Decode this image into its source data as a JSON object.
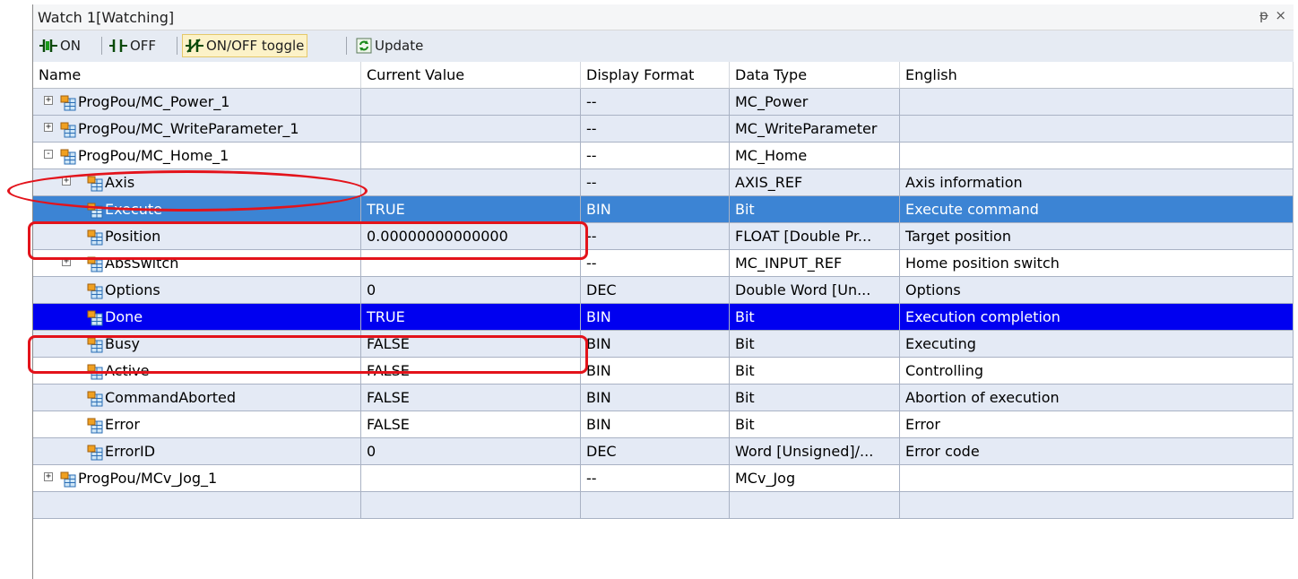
{
  "window": {
    "title": "Watch 1[Watching]",
    "pin_glyph": "ᵽ",
    "close_glyph": "×"
  },
  "toolbar": {
    "on_label": "ON",
    "off_label": "OFF",
    "toggle_label": "ON/OFF toggle",
    "update_label": "Update"
  },
  "columns": [
    "Name",
    "Current Value",
    "Display Format",
    "Data Type",
    "English"
  ],
  "rows": [
    {
      "name": "ProgPou/MC_Power_1",
      "value": "",
      "format": "--",
      "type": "MC_Power",
      "english": "",
      "level": 0,
      "expander": "+",
      "style": "alt"
    },
    {
      "name": "ProgPou/MC_WriteParameter_1",
      "value": "",
      "format": "--",
      "type": "MC_WriteParameter",
      "english": "",
      "level": 0,
      "expander": "+",
      "style": "alt"
    },
    {
      "name": "ProgPou/MC_Home_1",
      "value": "",
      "format": "--",
      "type": "MC_Home",
      "english": "",
      "level": 0,
      "expander": "-",
      "style": "plain"
    },
    {
      "name": "Axis",
      "value": "",
      "format": "--",
      "type": "AXIS_REF",
      "english": "Axis information",
      "level": 1,
      "expander": "+",
      "style": "alt"
    },
    {
      "name": "Execute",
      "value": "TRUE",
      "format": "BIN",
      "type": "Bit",
      "english": "Execute command",
      "level": 1,
      "expander": "",
      "style": "sel1"
    },
    {
      "name": "Position",
      "value": "0.00000000000000",
      "format": "--",
      "type": "FLOAT [Double Pr...",
      "english": "Target position",
      "level": 1,
      "expander": "",
      "style": "alt"
    },
    {
      "name": "AbsSwitch",
      "value": "",
      "format": "--",
      "type": "MC_INPUT_REF",
      "english": "Home position switch",
      "level": 1,
      "expander": "+",
      "style": "plain"
    },
    {
      "name": "Options",
      "value": "0",
      "format": "DEC",
      "type": "Double Word [Un...",
      "english": "Options",
      "level": 1,
      "expander": "",
      "style": "alt"
    },
    {
      "name": "Done",
      "value": "TRUE",
      "format": "BIN",
      "type": "Bit",
      "english": "Execution completion",
      "level": 1,
      "expander": "",
      "style": "sel2"
    },
    {
      "name": "Busy",
      "value": "FALSE",
      "format": "BIN",
      "type": "Bit",
      "english": "Executing",
      "level": 1,
      "expander": "",
      "style": "alt"
    },
    {
      "name": "Active",
      "value": "FALSE",
      "format": "BIN",
      "type": "Bit",
      "english": "Controlling",
      "level": 1,
      "expander": "",
      "style": "plain"
    },
    {
      "name": "CommandAborted",
      "value": "FALSE",
      "format": "BIN",
      "type": "Bit",
      "english": "Abortion of execution",
      "level": 1,
      "expander": "",
      "style": "alt"
    },
    {
      "name": "Error",
      "value": "FALSE",
      "format": "BIN",
      "type": "Bit",
      "english": "Error",
      "level": 1,
      "expander": "",
      "style": "plain"
    },
    {
      "name": "ErrorID",
      "value": "0",
      "format": "DEC",
      "type": "Word [Unsigned]/...",
      "english": "Error code",
      "level": 1,
      "expander": "",
      "style": "alt"
    },
    {
      "name": "ProgPou/MCv_Jog_1",
      "value": "",
      "format": "--",
      "type": "MCv_Jog",
      "english": "",
      "level": 0,
      "expander": "+",
      "style": "plain"
    },
    {
      "name": "",
      "value": "",
      "format": "",
      "type": "",
      "english": "",
      "level": 0,
      "expander": "",
      "style": "alt"
    }
  ],
  "colors": {
    "selected": "#3c84d4",
    "selected_focus": "#0000f0",
    "alt_row": "#e4eaf5",
    "annotation": "#e3131b"
  },
  "icons": {
    "variable": "variable-icon",
    "expand": "expand-icon",
    "collapse": "collapse-icon"
  }
}
